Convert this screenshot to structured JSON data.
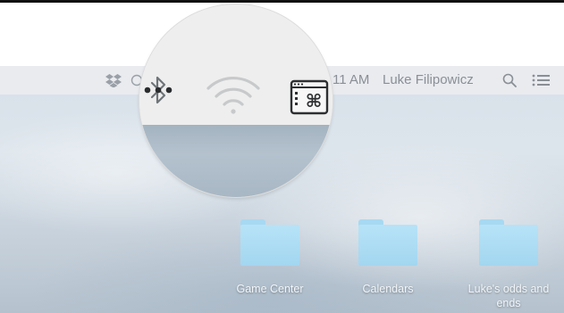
{
  "menubar": {
    "time": "11 AM",
    "user_name": "Luke Filipowicz",
    "icons": [
      "dropbox-icon",
      "bluetooth-icon",
      "wifi-icon",
      "keyboard-command-icon",
      "search-icon",
      "list-icon"
    ]
  },
  "magnifier": {
    "icons": [
      "bluetooth-icon",
      "wifi-icon",
      "keyboard-command-icon"
    ],
    "command_glyph": "⌘"
  },
  "desktop": {
    "folders": [
      {
        "label": "Game Center"
      },
      {
        "label": "Calendars"
      },
      {
        "label": "Luke's odds and ends"
      }
    ]
  },
  "colors": {
    "folder": "#a9dbf3",
    "menubar": "#e9ebee",
    "menubar_text": "#8a8f96"
  }
}
